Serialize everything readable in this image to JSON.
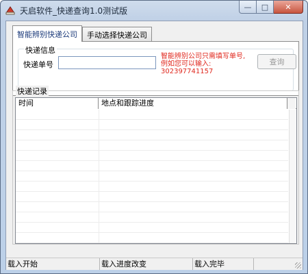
{
  "window": {
    "title": "天启软件_快递查询1.0测试版",
    "controls": {
      "minimize": "—",
      "maximize": "□",
      "close": "✕"
    }
  },
  "tabs": [
    {
      "label": "智能辨别快递公司",
      "selected": true
    },
    {
      "label": "手动选择快递公司",
      "selected": false
    }
  ],
  "express_info": {
    "group_label": "快递信息",
    "field_label": "快递单号",
    "tracking_number_value": "",
    "hint_line1": "智能辨别公司只需填写单号,",
    "hint_line2": "例如您可以输入:",
    "hint_example": "302397741157",
    "query_button": "查询"
  },
  "records": {
    "group_label": "快递记录",
    "columns": [
      "时间",
      "地点和跟踪进度"
    ],
    "rows": []
  },
  "statusbar": [
    "载入开始",
    "载入进度改变",
    "载入完毕",
    ""
  ],
  "colors": {
    "hint": "#e0281e",
    "title_gradient": "#bfd0e6",
    "close_button": "#c8553f"
  }
}
